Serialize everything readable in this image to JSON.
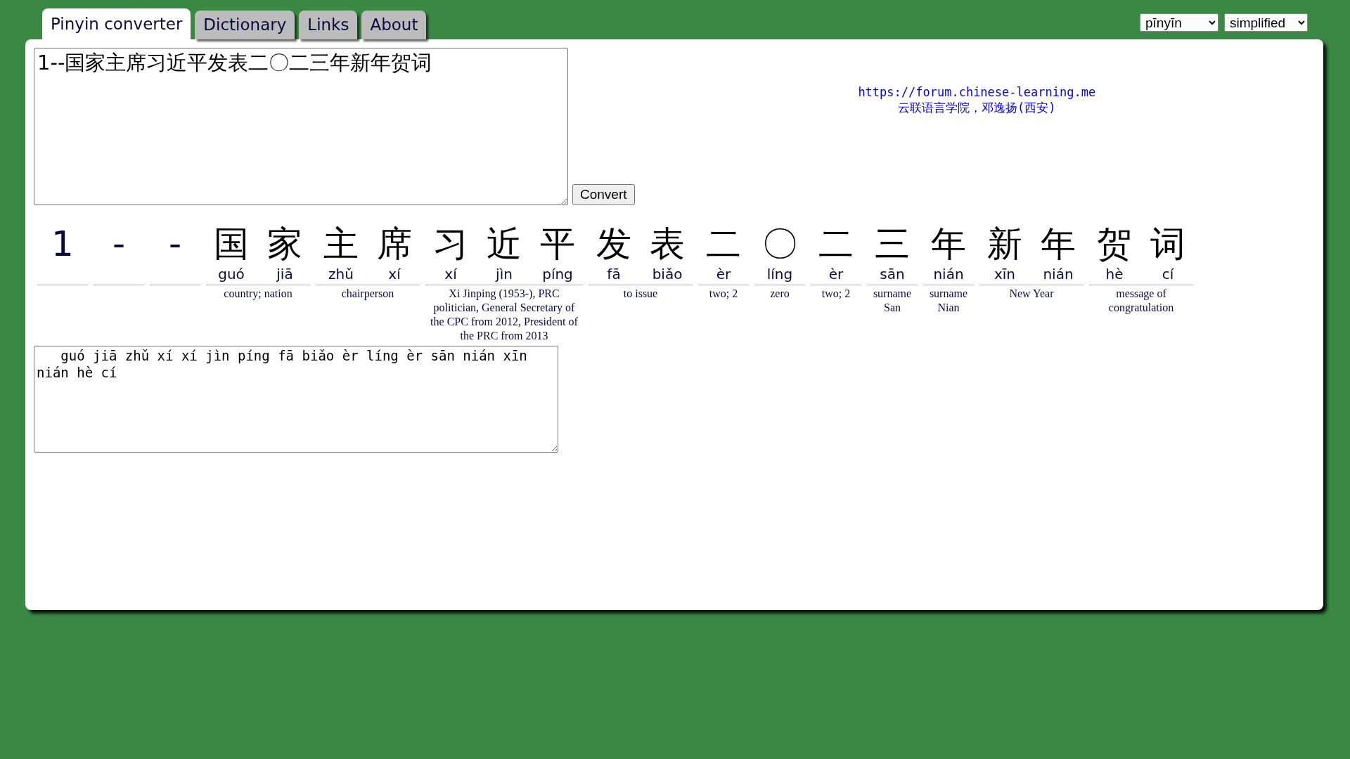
{
  "tabs": [
    {
      "label": "Pinyin converter",
      "selected": true
    },
    {
      "label": "Dictionary",
      "selected": false
    },
    {
      "label": "Links",
      "selected": false
    },
    {
      "label": "About",
      "selected": false
    }
  ],
  "selects": [
    {
      "value": "pīnyīn"
    },
    {
      "value": "simplified"
    }
  ],
  "input": {
    "value": "1--国家主席习近平发表二〇二三年新年贺词"
  },
  "convert_button": "Convert",
  "credit": {
    "link": "https://forum.chinese-learning.me",
    "text": "云联语言学院，邓逸扬(西安)"
  },
  "words": [
    {
      "chars": [
        {
          "kind": "other",
          "char": "1"
        }
      ]
    },
    {
      "chars": [
        {
          "kind": "other",
          "char": "-"
        }
      ]
    },
    {
      "chars": [
        {
          "kind": "other",
          "char": "-"
        }
      ]
    },
    {
      "chars": [
        {
          "kind": "hanzi",
          "char": "国",
          "pinyin": "guó"
        },
        {
          "kind": "hanzi",
          "char": "家",
          "pinyin": "jiā"
        }
      ],
      "definition": "country; nation"
    },
    {
      "chars": [
        {
          "kind": "hanzi",
          "char": "主",
          "pinyin": "zhǔ"
        },
        {
          "kind": "hanzi",
          "char": "席",
          "pinyin": "xí"
        }
      ],
      "definition": "chairperson"
    },
    {
      "chars": [
        {
          "kind": "hanzi",
          "char": "习",
          "pinyin": "xí"
        },
        {
          "kind": "hanzi",
          "char": "近",
          "pinyin": "jìn"
        },
        {
          "kind": "hanzi",
          "char": "平",
          "pinyin": "píng"
        }
      ],
      "definition": "Xi Jinping (1953-), PRC politician, General Secretary of the CPC from 2012, President of the PRC from 2013"
    },
    {
      "chars": [
        {
          "kind": "hanzi",
          "char": "发",
          "pinyin": "fā"
        },
        {
          "kind": "hanzi",
          "char": "表",
          "pinyin": "biǎo"
        }
      ],
      "definition": "to issue"
    },
    {
      "chars": [
        {
          "kind": "hanzi",
          "char": "二",
          "pinyin": "èr"
        }
      ],
      "definition": "two; 2"
    },
    {
      "chars": [
        {
          "kind": "hanzi",
          "char": "〇",
          "pinyin": "líng"
        }
      ],
      "definition": "zero"
    },
    {
      "chars": [
        {
          "kind": "hanzi",
          "char": "二",
          "pinyin": "èr"
        }
      ],
      "definition": "two; 2"
    },
    {
      "chars": [
        {
          "kind": "hanzi",
          "char": "三",
          "pinyin": "sān"
        }
      ],
      "definition": "surname San"
    },
    {
      "chars": [
        {
          "kind": "hanzi",
          "char": "年",
          "pinyin": "nián"
        }
      ],
      "definition": "surname Nian"
    },
    {
      "chars": [
        {
          "kind": "hanzi",
          "char": "新",
          "pinyin": "xīn"
        },
        {
          "kind": "hanzi",
          "char": "年",
          "pinyin": "nián"
        }
      ],
      "definition": "New Year"
    },
    {
      "chars": [
        {
          "kind": "hanzi",
          "char": "贺",
          "pinyin": "hè"
        },
        {
          "kind": "hanzi",
          "char": "词",
          "pinyin": "cí"
        }
      ],
      "definition": "message of congratulation"
    }
  ],
  "output": {
    "value": "   guó jiā zhǔ xí xí jìn píng fā biǎo èr líng èr sān nián xīn nián hè cí"
  }
}
